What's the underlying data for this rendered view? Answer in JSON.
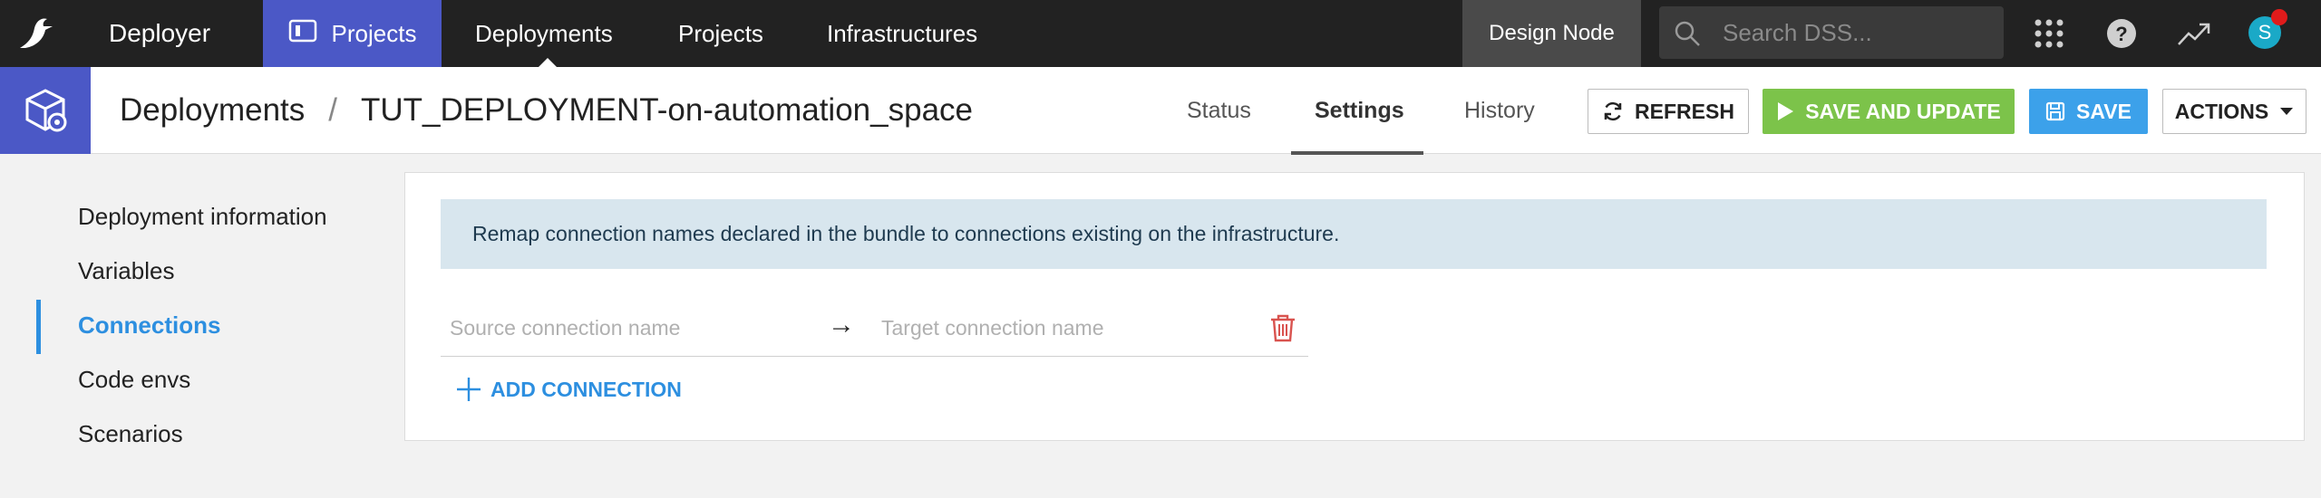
{
  "topnav": {
    "app_name": "Deployer",
    "projects_button": "Projects",
    "links": [
      "Deployments",
      "Projects",
      "Infrastructures"
    ],
    "design_node": "Design Node",
    "search_placeholder": "Search DSS...",
    "avatar_letter": "S",
    "icons": [
      "bird-logo-icon",
      "grid-apps-icon",
      "help-icon",
      "trending-icon"
    ]
  },
  "header": {
    "breadcrumb_root": "Deployments",
    "breadcrumb_sep": "/",
    "breadcrumb_current": "TUT_DEPLOYMENT-on-automation_space",
    "tabs": [
      "Status",
      "Settings",
      "History"
    ],
    "active_tab": "Settings",
    "buttons": {
      "refresh": "REFRESH",
      "save_update": "SAVE AND UPDATE",
      "save": "SAVE",
      "actions": "ACTIONS"
    }
  },
  "sidebar": {
    "items": [
      "Deployment information",
      "Variables",
      "Connections",
      "Code envs",
      "Scenarios"
    ],
    "active": "Connections"
  },
  "main": {
    "info_text": "Remap connection names declared in the bundle to connections existing on the infrastructure.",
    "source_placeholder": "Source connection name",
    "target_placeholder": "Target connection name",
    "arrow": "→",
    "add_connection": "ADD CONNECTION"
  },
  "colors": {
    "nav_bg": "#222222",
    "accent_indigo": "#4b58c6",
    "save_update_green": "#7cc34a",
    "save_blue": "#3ca1ea",
    "link_blue": "#2d8fe0",
    "info_bg": "#d8e6ee",
    "delete_red": "#d9534f"
  }
}
